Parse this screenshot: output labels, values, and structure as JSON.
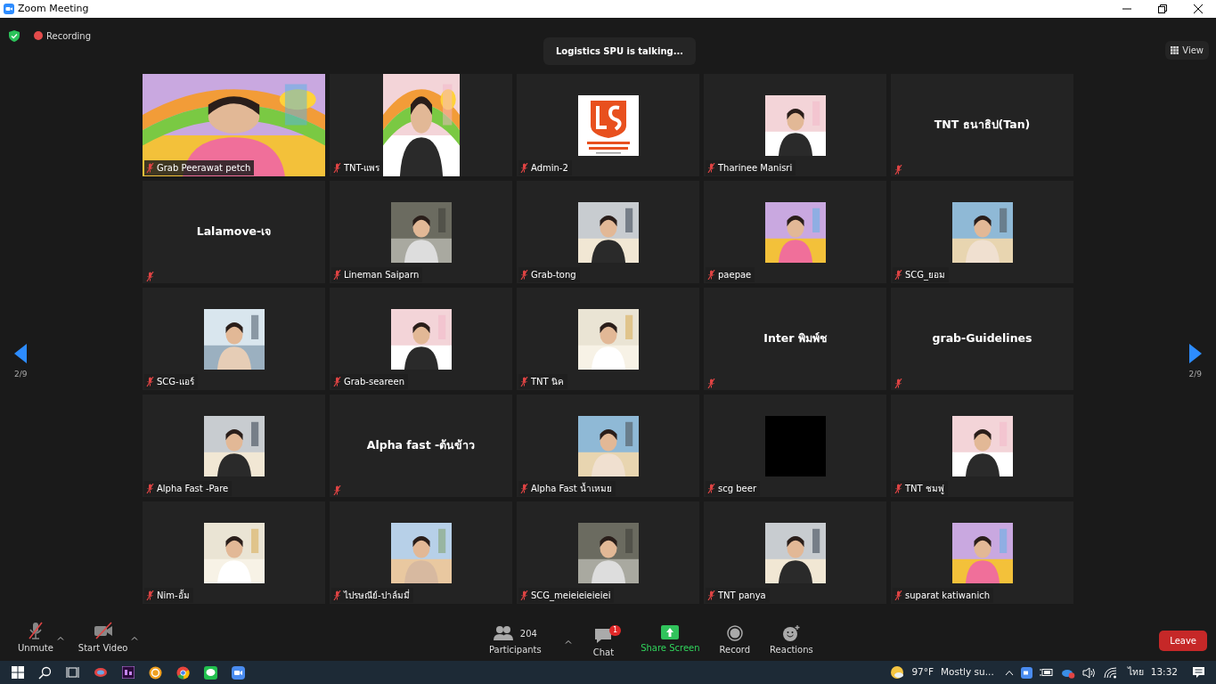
{
  "window": {
    "title": "Zoom Meeting"
  },
  "top_bar": {
    "recording": "Recording",
    "speaker_toast": "Logistics SPU is talking...",
    "view_button": "View"
  },
  "pager": {
    "left": "2/9",
    "right": "2/9"
  },
  "tiles": [
    {
      "kind": "video",
      "label": "Grab Peerawat petch",
      "muted": true
    },
    {
      "kind": "video_narrow",
      "label": "TNT-แพร",
      "muted": true
    },
    {
      "kind": "logo",
      "label": "Admin-2",
      "muted": true
    },
    {
      "label": "Tharinee Manisri",
      "muted": true
    },
    {
      "kind": "name",
      "display_name": "TNT ธนาธิป(Tan)",
      "muted": true
    },
    {
      "kind": "name",
      "display_name": "Lalamove-เจ",
      "muted": true
    },
    {
      "label": "Lineman Saiparn",
      "muted": true
    },
    {
      "label": "Grab-tong",
      "muted": true
    },
    {
      "label": "paepae",
      "muted": true
    },
    {
      "label": "SCG_ยอม",
      "muted": true
    },
    {
      "label": "SCG-แอร์",
      "muted": true
    },
    {
      "label": "Grab-seareen",
      "muted": true
    },
    {
      "label": "TNT นิค",
      "muted": true
    },
    {
      "kind": "name",
      "display_name": "Inter พิมพ์ช",
      "muted": true
    },
    {
      "kind": "name",
      "display_name": "grab-Guidelines",
      "muted": true
    },
    {
      "label": "Alpha Fast -Pare",
      "muted": true
    },
    {
      "kind": "name",
      "display_name": "Alpha fast -ต้นข้าว",
      "muted": true
    },
    {
      "label": "Alpha Fast น้ำเหมย",
      "muted": true
    },
    {
      "kind": "black",
      "label": "scg beer",
      "muted": true
    },
    {
      "label": "TNT ชมพู่",
      "muted": true
    },
    {
      "label": "Nim-อั้ม",
      "muted": true
    },
    {
      "label": "ไปรษณีย์-ปาล์มมี่",
      "muted": true
    },
    {
      "label": "SCG_meieieieieiei",
      "muted": true
    },
    {
      "label": "TNT panya",
      "muted": true
    },
    {
      "label": "suparat katiwanich",
      "muted": true
    }
  ],
  "toolbar": {
    "left": [
      {
        "kind": "mic",
        "label": "Unmute",
        "off": true
      },
      {
        "kind": "camera",
        "label": "Start Video",
        "off": true
      }
    ],
    "center": [
      {
        "kind": "participants",
        "label": "Participants",
        "count": "204"
      },
      {
        "kind": "chat",
        "label": "Chat",
        "badge": "1"
      },
      {
        "kind": "share",
        "label": "Share Screen"
      },
      {
        "kind": "record",
        "label": "Record"
      },
      {
        "kind": "reactions",
        "label": "Reactions"
      }
    ],
    "leave": "Leave"
  },
  "taskbar": {
    "temperature": "97°F",
    "weather": "Mostly su...",
    "language": "ไทย",
    "time": "13:32"
  }
}
